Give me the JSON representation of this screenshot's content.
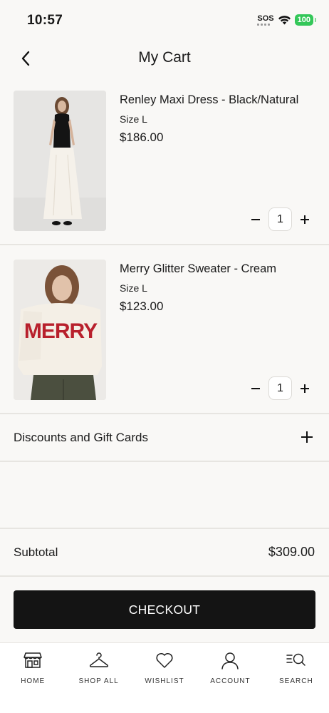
{
  "status": {
    "time": "10:57",
    "sos": "SOS",
    "battery": "100"
  },
  "header": {
    "title": "My Cart"
  },
  "cart": {
    "items": [
      {
        "name": "Renley Maxi Dress - Black/Natural",
        "size": "Size L",
        "price": "$186.00",
        "quantity": "1",
        "image": "model-black-top-cream-maxi-skirt"
      },
      {
        "name": "Merry Glitter Sweater - Cream",
        "size": "Size L",
        "price": "$123.00",
        "quantity": "1",
        "image": "model-cream-sweater-red-merry"
      }
    ]
  },
  "discounts": {
    "label": "Discounts and Gift Cards"
  },
  "summary": {
    "subtotal_label": "Subtotal",
    "subtotal_value": "$309.00"
  },
  "checkout": {
    "label": "CHECKOUT"
  },
  "tabbar": {
    "tabs": [
      {
        "label": "HOME",
        "icon": "storefront-icon"
      },
      {
        "label": "SHOP ALL",
        "icon": "hanger-icon"
      },
      {
        "label": "WISHLIST",
        "icon": "heart-icon"
      },
      {
        "label": "ACCOUNT",
        "icon": "person-icon"
      },
      {
        "label": "SEARCH",
        "icon": "search-icon"
      }
    ]
  },
  "colors": {
    "background": "#f9f8f6",
    "checkout_button": "#141414",
    "battery_green": "#34c759",
    "sweater_text_red": "#b8202c"
  }
}
